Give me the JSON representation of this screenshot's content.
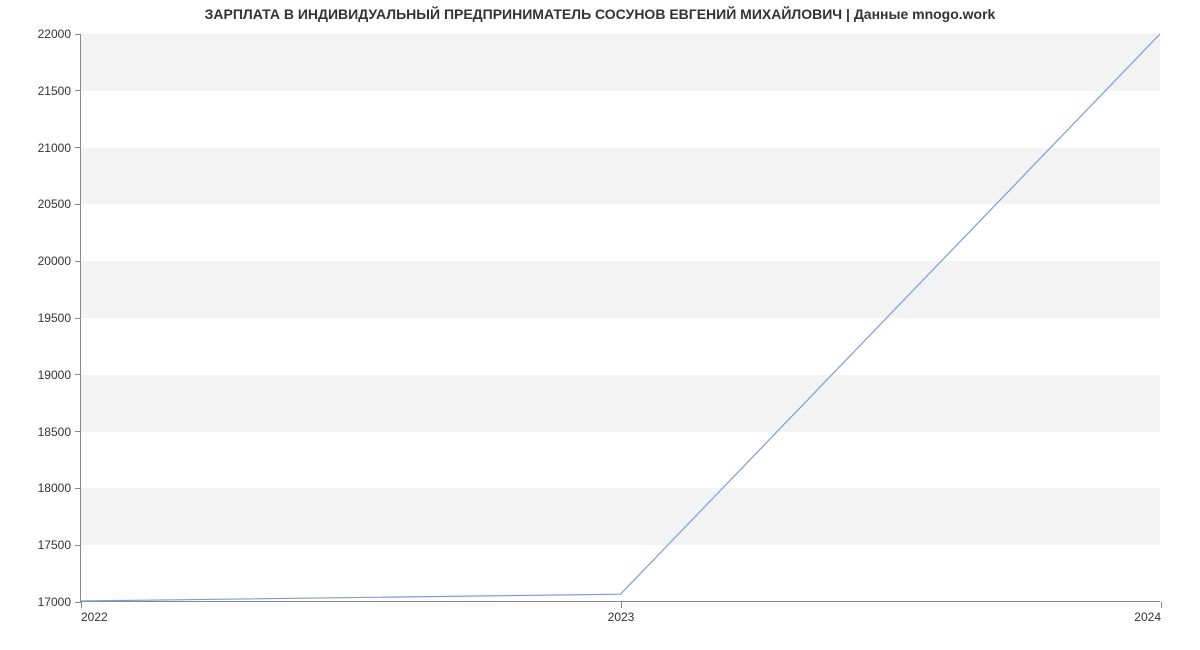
{
  "chart_data": {
    "type": "line",
    "title": "ЗАРПЛАТА В ИНДИВИДУАЛЬНЫЙ ПРЕДПРИНИМАТЕЛЬ СОСУНОВ ЕВГЕНИЙ МИХАЙЛОВИЧ | Данные mnogo.work",
    "x": [
      2022,
      2023,
      2024
    ],
    "values": [
      17000,
      17060,
      22000
    ],
    "xlabel": "",
    "ylabel": "",
    "xticks": [
      2022,
      2023,
      2024
    ],
    "yticks": [
      17000,
      17500,
      18000,
      18500,
      19000,
      19500,
      20000,
      20500,
      21000,
      21500,
      22000
    ],
    "xlim": [
      2022,
      2024
    ],
    "ylim": [
      17000,
      22000
    ],
    "line_color": "#7a9ed9",
    "band_color": "#f3f3f3"
  }
}
